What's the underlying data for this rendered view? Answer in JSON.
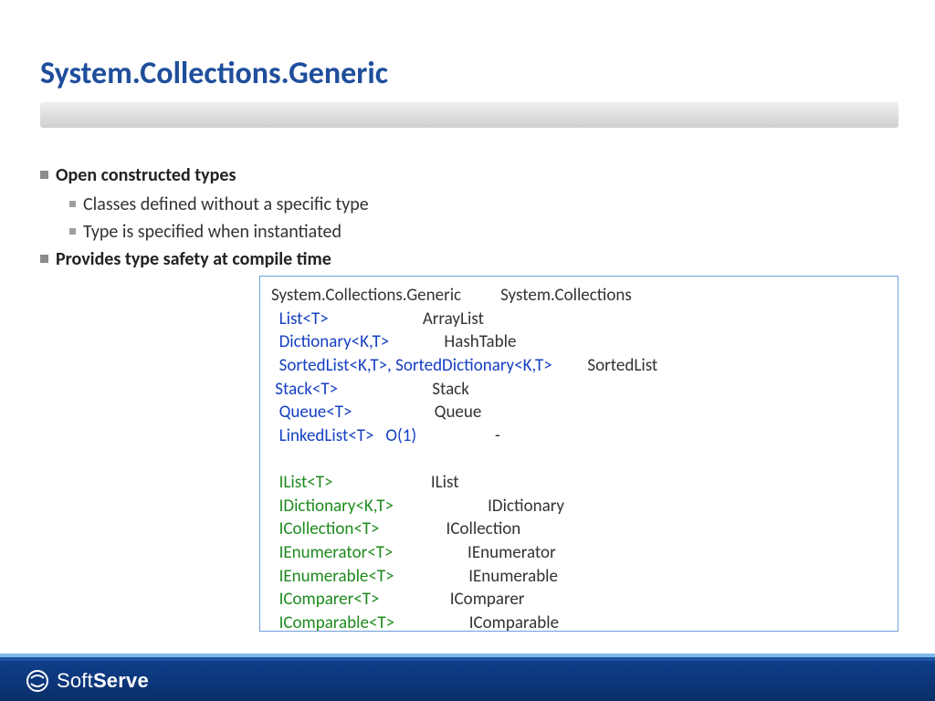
{
  "title": "System.Collections.Generic",
  "bullets": {
    "b1": "Open constructed types",
    "b1a": "Classes defined without a specific type",
    "b1b": "Type is specified when instantiated",
    "b2": "Provides type safety at compile time"
  },
  "code": {
    "header_left": "System.Collections.Generic",
    "header_right": "System.Collections",
    "rows": {
      "list_g": "List<T>",
      "list_n": "ArrayList",
      "dict_g": "Dictionary<K,T>",
      "dict_n": "HashTable",
      "sorted_g": "SortedList<K,T>, SortedDictionary<K,T>",
      "sorted_n": "SortedList",
      "stack_g": "Stack<T>",
      "stack_n": "Stack",
      "queue_g": "Queue<T>",
      "queue_n": "Queue",
      "linked_g": "LinkedList<T>   O(1)",
      "linked_n": "-",
      "ilist_g": "IList<T>",
      "ilist_n": "IList",
      "idict_g": "IDictionary<K,T>",
      "idict_n": "IDictionary",
      "icoll_g": "ICollection<T>",
      "icoll_n": "ICollection",
      "ienumor_g": "IEnumerator<T>",
      "ienumor_n": "IEnumerator",
      "ienumbl_g": "IEnumerable<T>",
      "ienumbl_n": "IEnumerable",
      "icomp_g": "IComparer<T>",
      "icomp_n": "IComparer",
      "icompable_g": "IComparable<T>",
      "icompable_n": "IComparable"
    }
  },
  "brand": {
    "soft": "Soft",
    "serve": "Serve"
  }
}
